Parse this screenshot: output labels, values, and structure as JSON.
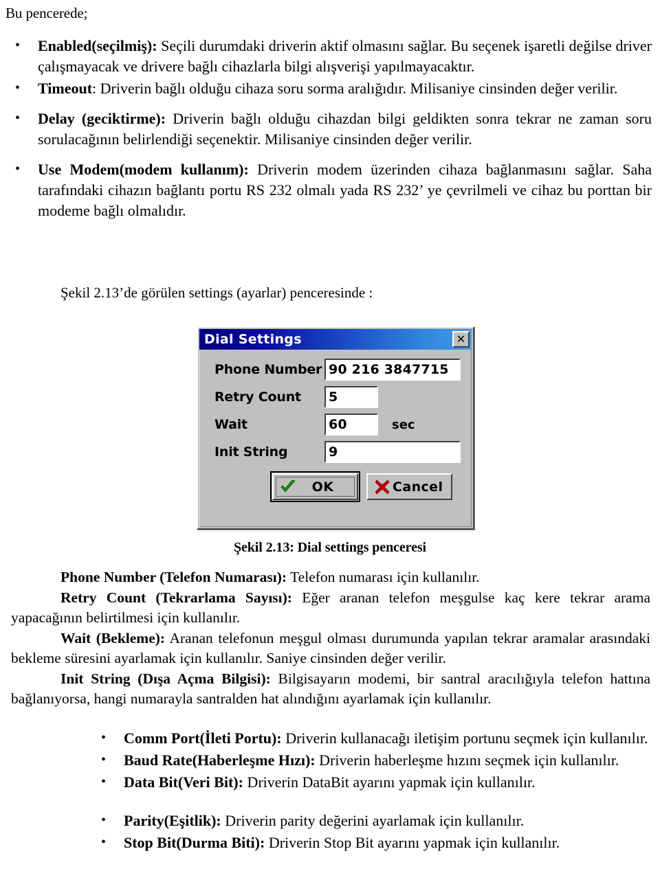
{
  "document": {
    "intro_line": "Bu pencerede;",
    "figure_reference": "Şekil 2.13’de görülen settings (ayarlar) penceresinde :",
    "figure_caption": "Şekil 2.13: Dial settings penceresi"
  },
  "top_list": [
    {
      "term": "Enabled(seçilmiş):",
      "text": " Seçili durumdaki driverin aktif olmasını sağlar. Bu seçenek işaretli değilse driver çalışmayacak ve drivere bağlı cihazlarla bilgi alışverişi yapılmayacaktır."
    },
    {
      "term": "Timeout",
      "text": ": Driverin bağlı olduğu cihaza soru sorma aralığıdır. Milisaniye cinsinden değer verilir."
    },
    {
      "term": "Delay (geciktirme):",
      "text": " Driverin bağlı olduğu cihazdan bilgi geldikten sonra tekrar ne zaman soru sorulacağının belirlendiği seçenektir. Milisaniye cinsinden değer verilir."
    },
    {
      "term": "Use Modem(modem kullanım):",
      "text": " Driverin modem üzerinden cihaza bağlanmasını sağlar. Saha tarafındaki cihazın bağlantı portu RS 232 olmalı yada RS 232’ ye çevrilmeli ve cihaz bu porttan bir modeme bağlı olmalıdır."
    }
  ],
  "dialog": {
    "title": "Dial Settings",
    "close_label": "✕",
    "fields": [
      {
        "label": "Phone Number",
        "value": "90 216 3847715",
        "suffix": ""
      },
      {
        "label": "Retry Count",
        "value": "5",
        "suffix": ""
      },
      {
        "label": "Wait",
        "value": "60",
        "suffix": "sec"
      },
      {
        "label": "Init String",
        "value": "9",
        "suffix": ""
      }
    ],
    "ok_label": "OK",
    "cancel_label": "Cancel",
    "colors": {
      "titlebar_left": "#00007b",
      "titlebar_right": "#3e9ce8",
      "face": "#c0c0c0",
      "ok_check": "#00a000",
      "cancel_x": "#c00000"
    }
  },
  "descriptions": [
    {
      "term": "Phone Number (Telefon Numarası):",
      "text": " Telefon  numarası için kullanılır."
    },
    {
      "term": "Retry Count (Tekrarlama Sayısı):",
      "text": " Eğer aranan telefon meşgulse kaç kere tekrar arama yapacağının belirtilmesi için kullanılır."
    },
    {
      "term": "Wait (Bekleme):",
      "text": " Aranan telefonun meşgul olması durumunda yapılan tekrar aramalar arasındaki bekleme süresini ayarlamak için kullanılır. Saniye cinsinden değer verilir."
    },
    {
      "term": "Init String (Dışa Açma Bilgisi):",
      "text": " Bilgisayarın modemi, bir santral aracılığıyla telefon hattına bağlanıyorsa, hangi numarayla santralden hat alındığını ayarlamak için kullanılır."
    }
  ],
  "bottom_list": [
    {
      "term": "Comm Port(İleti Portu):",
      "text": " Driverin kullanacağı iletişim portunu seçmek için kullanılır."
    },
    {
      "term": "Baud Rate(Haberleşme Hızı):",
      "text": " Driverin haberleşme hızını seçmek için kullanılır."
    },
    {
      "term": "Data Bit(Veri Bit):",
      "text": " Driverin DataBit ayarını yapmak için kullanılır."
    },
    {
      "term": "Parity(Eşitlik):",
      "text": " Driverin parity değerini ayarlamak için kullanılır."
    },
    {
      "term": "Stop Bit(Durma Biti):",
      "text": " Driverin Stop Bit ayarını yapmak için kullanılır."
    }
  ]
}
